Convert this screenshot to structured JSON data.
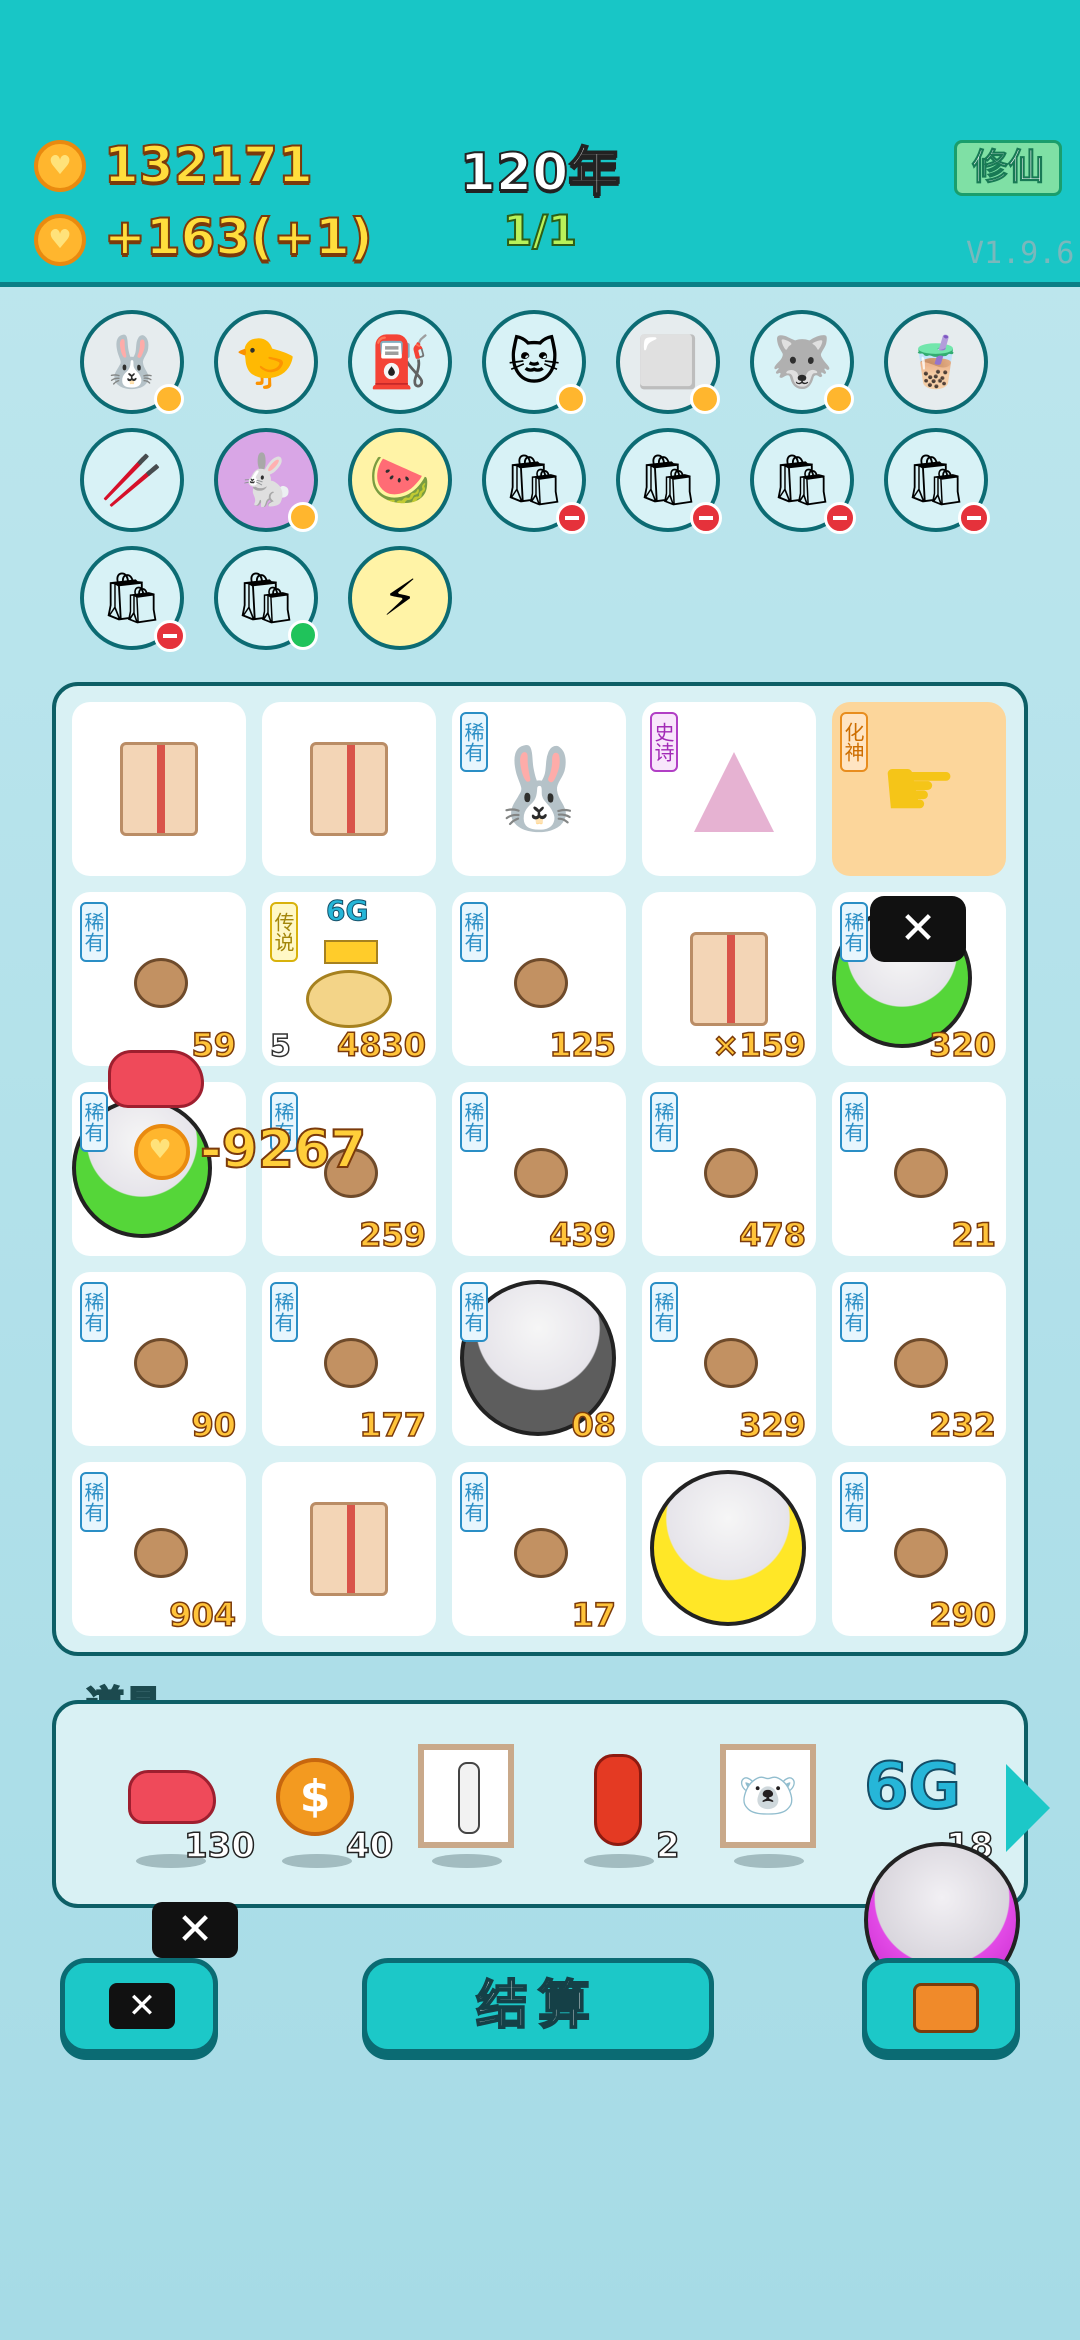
{
  "header": {
    "coins": "132171",
    "income": "+163(+1)",
    "year": "120年",
    "progress": "1/1",
    "mode_button": "修仙",
    "version": "V1.9.6"
  },
  "colors": {
    "primary": "#18c6c6",
    "panel_border": "#0d5f66",
    "coin": "#ffb62e"
  },
  "collection": [
    {
      "icon": "rabbit-icon",
      "glyph": "🐰",
      "bg": "#e6ecee",
      "badge": "heart"
    },
    {
      "icon": "chick-icon",
      "glyph": "🐤",
      "bg": "#e6ecee",
      "badge": ""
    },
    {
      "icon": "pump-icon",
      "glyph": "⛽",
      "bg": "#d8f2f6",
      "badge": ""
    },
    {
      "icon": "cat-icon",
      "glyph": "🐱",
      "bg": "#d8f2f6",
      "badge": "heart"
    },
    {
      "icon": "sugar-cubes-icon",
      "glyph": "⬜",
      "bg": "#e6ecee",
      "badge": "heart"
    },
    {
      "icon": "husky-icon",
      "glyph": "🐺",
      "bg": "#d8f2f6",
      "badge": "heart"
    },
    {
      "icon": "bubble-tea-icon",
      "glyph": "🧋",
      "bg": "#e6ecee",
      "badge": ""
    },
    {
      "icon": "chopsticks-icon",
      "glyph": "🥢",
      "bg": "#d8f2f6",
      "badge": ""
    },
    {
      "icon": "pink-rabbit-icon",
      "glyph": "🐇",
      "bg": "#d9a6e6",
      "badge": "heart"
    },
    {
      "icon": "fruit-platter-icon",
      "glyph": "🍉",
      "bg": "#fff3a6",
      "badge": ""
    },
    {
      "icon": "sack-icon",
      "glyph": "🛍",
      "bg": "#d8f2f6",
      "badge": "minus"
    },
    {
      "icon": "sack-icon",
      "glyph": "🛍",
      "bg": "#d8f2f6",
      "badge": "minus"
    },
    {
      "icon": "sack-icon",
      "glyph": "🛍",
      "bg": "#d8f2f6",
      "badge": "minus"
    },
    {
      "icon": "sack-icon",
      "glyph": "🛍",
      "bg": "#d8f2f6",
      "badge": "minus"
    },
    {
      "icon": "sack-icon",
      "glyph": "🛍",
      "bg": "#d8f2f6",
      "badge": "minus"
    },
    {
      "icon": "sack-icon",
      "glyph": "🛍",
      "bg": "#d8f2f6",
      "badge": "green"
    },
    {
      "icon": "lightning-icon",
      "glyph": "⚡",
      "bg": "#fff3a6",
      "badge": ""
    }
  ],
  "board": [
    [
      {
        "tag": "",
        "tag_type": "",
        "icon": "box",
        "count": "",
        "level": ""
      },
      {
        "tag": "",
        "tag_type": "",
        "icon": "box",
        "count": "",
        "level": ""
      },
      {
        "tag": "稀有",
        "tag_type": "rare",
        "icon": "rabbit",
        "count": "",
        "level": ""
      },
      {
        "tag": "史诗",
        "tag_type": "epic",
        "icon": "rabbit-house",
        "count": "",
        "level": ""
      },
      {
        "tag": "化神",
        "tag_type": "deity",
        "icon": "hand-pointer",
        "count": "",
        "level": ""
      }
    ],
    [
      {
        "tag": "稀有",
        "tag_type": "rare",
        "icon": "potato",
        "count": "59",
        "level": ""
      },
      {
        "tag": "传说",
        "tag_type": "legend",
        "icon": "golden-potato",
        "count": "4830",
        "level": "5"
      },
      {
        "tag": "稀有",
        "tag_type": "rare",
        "icon": "potato",
        "count": "125",
        "level": ""
      },
      {
        "tag": "",
        "tag_type": "",
        "icon": "box",
        "count": "×159",
        "level": ""
      },
      {
        "tag": "稀有",
        "tag_type": "rare",
        "icon": "green-ball",
        "count": "320",
        "level": ""
      }
    ],
    [
      {
        "tag": "稀有",
        "tag_type": "rare",
        "icon": "green-ball",
        "count": "",
        "level": ""
      },
      {
        "tag": "稀有",
        "tag_type": "rare",
        "icon": "potato",
        "count": "259",
        "level": ""
      },
      {
        "tag": "稀有",
        "tag_type": "rare",
        "icon": "potato",
        "count": "439",
        "level": ""
      },
      {
        "tag": "稀有",
        "tag_type": "rare",
        "icon": "potato",
        "count": "478",
        "level": ""
      },
      {
        "tag": "稀有",
        "tag_type": "rare",
        "icon": "potato",
        "count": "21",
        "level": ""
      }
    ],
    [
      {
        "tag": "稀有",
        "tag_type": "rare",
        "icon": "potato",
        "count": "90",
        "level": ""
      },
      {
        "tag": "稀有",
        "tag_type": "rare",
        "icon": "potato",
        "count": "177",
        "level": ""
      },
      {
        "tag": "稀有",
        "tag_type": "rare",
        "icon": "gray-ball",
        "count": "08",
        "level": ""
      },
      {
        "tag": "稀有",
        "tag_type": "rare",
        "icon": "potato",
        "count": "329",
        "level": ""
      },
      {
        "tag": "稀有",
        "tag_type": "rare",
        "icon": "potato",
        "count": "232",
        "level": ""
      }
    ],
    [
      {
        "tag": "稀有",
        "tag_type": "rare",
        "icon": "potato",
        "count": "904",
        "level": ""
      },
      {
        "tag": "",
        "tag_type": "",
        "icon": "box",
        "count": "",
        "level": ""
      },
      {
        "tag": "稀有",
        "tag_type": "rare",
        "icon": "potato",
        "count": "17",
        "level": ""
      },
      {
        "tag": "",
        "tag_type": "",
        "icon": "yellow-ball",
        "count": "",
        "level": ""
      },
      {
        "tag": "稀有",
        "tag_type": "rare",
        "icon": "potato",
        "count": "290",
        "level": ""
      }
    ]
  ],
  "golden_potato_label": "6G",
  "float_number": "-9267",
  "items": {
    "title": "道具",
    "list": [
      {
        "icon": "liver-icon",
        "count": "130"
      },
      {
        "icon": "dollar-coin-icon",
        "count": "40"
      },
      {
        "icon": "remote-card-icon",
        "count": ""
      },
      {
        "icon": "chili-icon",
        "count": "2"
      },
      {
        "icon": "cat-card-icon",
        "count": ""
      },
      {
        "icon": "6g-icon",
        "label": "6G",
        "count": "18"
      }
    ]
  },
  "buttons": {
    "settle": "结算"
  }
}
